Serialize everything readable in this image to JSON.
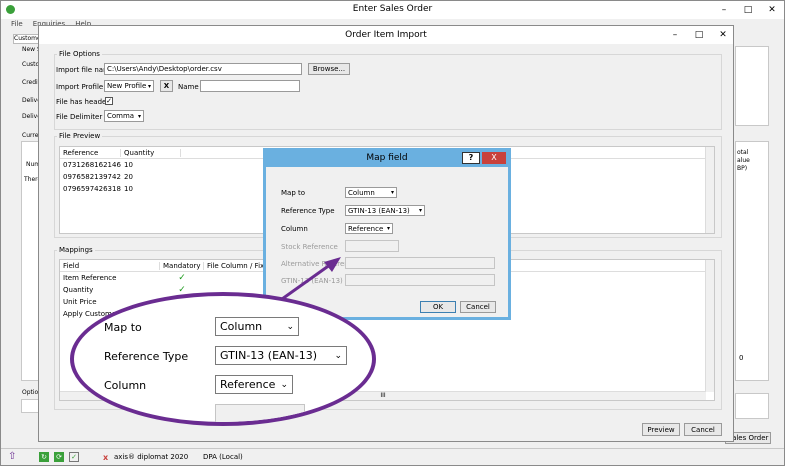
{
  "main_window": {
    "title": "Enter Sales Order",
    "menu": [
      "File",
      "Enquiries",
      "Help"
    ],
    "left_labels": [
      "Customer",
      "New S",
      "Custo",
      "Credit",
      "Delive",
      "Delive",
      "Curren",
      "Num",
      "There",
      "Optio"
    ],
    "right_labels": [
      "otal",
      "alue",
      "BP)"
    ],
    "right_zero": "0",
    "sales_order_btn": "Sales Order"
  },
  "import_dialog": {
    "title": "Order Item Import",
    "file_options": {
      "group": "File Options",
      "file_name_label": "Import file name",
      "file_name_value": "C:\\Users\\Andy\\Desktop\\order.csv",
      "browse": "Browse...",
      "profile_label": "Import Profile",
      "profile_value": "New Profile",
      "profile_clear": "X",
      "name_label": "Name",
      "name_value": "",
      "header_label": "File has header",
      "header_check": "✓",
      "delim_label": "File Delimiter",
      "delim_value": "Comma"
    },
    "file_preview": {
      "group": "File Preview",
      "columns": [
        "Reference",
        "Quantity"
      ],
      "rows": [
        [
          "0731268162146",
          "10"
        ],
        [
          "0976582139742",
          "20"
        ],
        [
          "0796597426318",
          "10"
        ]
      ]
    },
    "mappings": {
      "group": "Mappings",
      "columns": [
        "Field",
        "Mandatory",
        "File Column / Fixe"
      ],
      "rows": [
        {
          "field": "Item Reference",
          "mandatory": "✓"
        },
        {
          "field": "Quantity",
          "mandatory": "✓"
        },
        {
          "field": "Unit Price",
          "mandatory": ""
        },
        {
          "field": "Apply Custome",
          "mandatory": ""
        }
      ],
      "hscroll": "III"
    },
    "preview_btn": "Preview",
    "cancel_btn": "Cancel"
  },
  "map_dialog": {
    "title": "Map field",
    "help": "?",
    "close": "X",
    "map_to_label": "Map to",
    "map_to_value": "Column",
    "ref_type_label": "Reference Type",
    "ref_type_value": "GTIN-13 (EAN-13)",
    "column_label": "Column",
    "column_value": "Reference",
    "stock_ref_label": "Stock Reference",
    "alt_ref_label": "Alternative Reference",
    "gtin_label": "GTIN-13 (EAN-13)",
    "ok_btn": "OK",
    "cancel_btn": "Cancel"
  },
  "zoom_callout": {
    "map_to_label": "Map to",
    "map_to_value": "Column",
    "ref_type_label": "Reference Type",
    "ref_type_value": "GTIN-13 (EAN-13)",
    "column_label": "Column",
    "column_value": "Reference"
  },
  "status_bar": {
    "app_name": "axis® diplomat 2020",
    "db": "DPA (Local)"
  },
  "colors": {
    "accent": "#6a2c91",
    "check": "#1a9a1a",
    "close_red": "#c8413c"
  }
}
